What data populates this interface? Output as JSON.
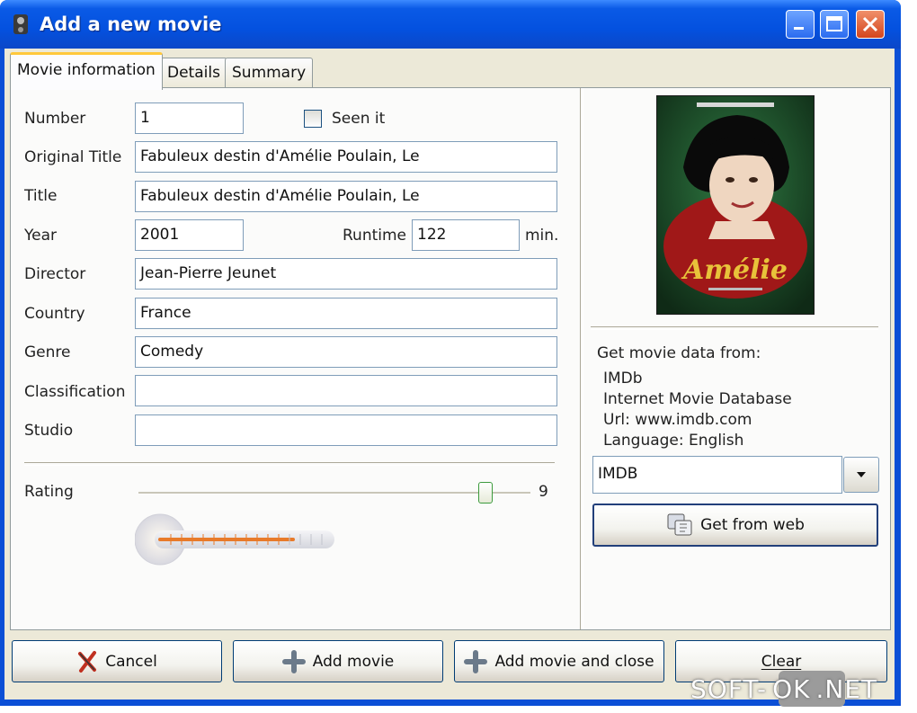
{
  "window": {
    "title": "Add a new movie"
  },
  "tabs": [
    "Movie information",
    "Details",
    "Summary"
  ],
  "form": {
    "number_label": "Number",
    "number_value": "1",
    "seen_label": "Seen it",
    "original_title_label": "Original Title",
    "original_title_value": "Fabuleux destin d'Amélie Poulain, Le",
    "title_label": "Title",
    "title_value": "Fabuleux destin d'Amélie Poulain, Le",
    "year_label": "Year",
    "year_value": "2001",
    "runtime_label": "Runtime",
    "runtime_value": "122",
    "runtime_unit": "min.",
    "director_label": "Director",
    "director_value": "Jean-Pierre Jeunet",
    "country_label": "Country",
    "country_value": "France",
    "genre_label": "Genre",
    "genre_value": "Comedy",
    "classification_label": "Classification",
    "classification_value": "",
    "studio_label": "Studio",
    "studio_value": "",
    "rating_label": "Rating",
    "rating_value": "9",
    "rating_fraction": 0.9
  },
  "poster": {
    "title_text": "Amélie",
    "accent_color": "#e8c23a",
    "background_color": "#1f4a2a"
  },
  "source": {
    "heading": "Get movie data from:",
    "name": "IMDb",
    "description": "Internet Movie Database",
    "url": "Url: www.imdb.com",
    "language": "Language: English",
    "selected": "IMDB",
    "get_button": "Get from web"
  },
  "buttons": {
    "cancel": "Cancel",
    "add": "Add movie",
    "add_close": "Add movie and close",
    "clear": "Clear"
  },
  "watermark": {
    "left": "SOFT-",
    "mid": "OK",
    "right": ".NET"
  },
  "colors": {
    "titlebar": "#0451df",
    "tab_highlight": "#ffc83c",
    "slider_accent": "#e87a2a"
  }
}
